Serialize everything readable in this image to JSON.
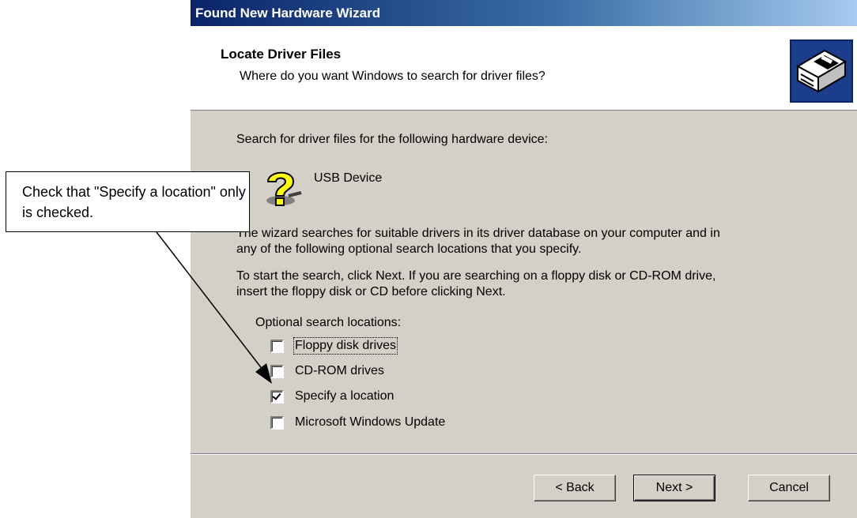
{
  "window": {
    "title": "Found New Hardware Wizard"
  },
  "header": {
    "title": "Locate Driver Files",
    "subtitle": "Where do you want Windows to search for driver files?",
    "icon": "hardware-install-icon"
  },
  "content": {
    "intro": "Search for driver files for the following hardware device:",
    "device_name": "USB Device",
    "device_icon": "unknown-device-question-icon",
    "description_line1": "The wizard searches for suitable drivers in its driver database on your computer and in",
    "description_line2": "any of the following optional search locations that you specify.",
    "instruction_line1": "To start the search, click Next. If you are searching on a floppy disk or CD-ROM drive,",
    "instruction_line2": "insert the floppy disk or CD before clicking Next.",
    "options_label": "Optional search locations:"
  },
  "options": [
    {
      "label": "Floppy disk drives",
      "checked": false,
      "focused": true
    },
    {
      "label": "CD-ROM drives",
      "checked": false,
      "focused": false
    },
    {
      "label": "Specify a location",
      "checked": true,
      "focused": false
    },
    {
      "label": "Microsoft Windows Update",
      "checked": false,
      "focused": false
    }
  ],
  "buttons": {
    "back": "< Back",
    "next": "Next >",
    "cancel": "Cancel"
  },
  "callout": {
    "text": "Check that \"Specify a location\" only is checked."
  },
  "colors": {
    "titlebar_start": "#0a246a",
    "titlebar_end": "#a6caf0",
    "dialog_face": "#d4d0c8"
  }
}
